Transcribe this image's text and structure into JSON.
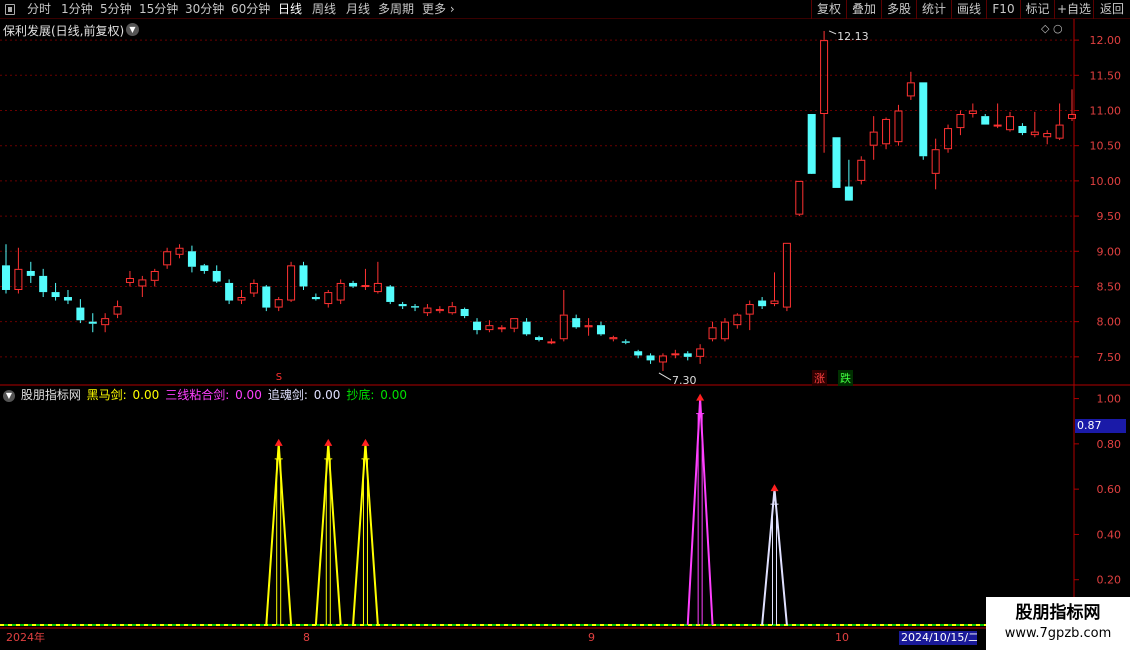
{
  "toolbar": {
    "left_items": [
      {
        "label": "分时",
        "active": false
      },
      {
        "label": "1分钟",
        "active": false
      },
      {
        "label": "5分钟",
        "active": false
      },
      {
        "label": "15分钟",
        "active": false
      },
      {
        "label": "30分钟",
        "active": false
      },
      {
        "label": "60分钟",
        "active": false
      },
      {
        "label": "日线",
        "active": true
      },
      {
        "label": "周线",
        "active": false
      },
      {
        "label": "月线",
        "active": false
      },
      {
        "label": "多周期",
        "active": false
      },
      {
        "label": "更多",
        "active": false
      }
    ],
    "right_items": [
      "复权",
      "叠加",
      "多股",
      "统计",
      "画线",
      "F10",
      "标记",
      "+自选",
      "返回"
    ]
  },
  "main_panel": {
    "title": "保利发展(日线,前复权)",
    "high_label": "12.13",
    "low_label": "7.30",
    "tag_up": "涨",
    "tag_down": "跌",
    "s_marker": "S"
  },
  "indicator_panel": {
    "name": "股朋指标网",
    "lines": [
      {
        "label": "黑马剑:",
        "value": "0.00",
        "color": "#ffff00"
      },
      {
        "label": "三线粘合剑:",
        "value": "0.00",
        "color": "#ff40ff"
      },
      {
        "label": "追魂剑:",
        "value": "0.00",
        "color": "#e0e0ff"
      },
      {
        "label": "抄底:",
        "value": "0.00",
        "color": "#00e000"
      }
    ],
    "current_value": "0.87"
  },
  "footer": {
    "year_label": "2024年",
    "month_labels": [
      "8",
      "9",
      "10"
    ],
    "selected_date": "2024/10/15/二"
  },
  "watermark": {
    "line1": "股朋指标网",
    "line2": "www.7gpzb.com"
  },
  "colors": {
    "up": "#ff3232",
    "down": "#54fcfc",
    "axis": "#b00000"
  },
  "chart_data": [
    {
      "type": "candlestick",
      "title": "保利发展(日线,前复权)",
      "y_ticks": [
        7.5,
        8.0,
        8.5,
        9.0,
        9.5,
        10.0,
        10.5,
        11.0,
        11.5,
        12.0
      ],
      "ylim": [
        7.1,
        12.3
      ],
      "high": 12.13,
      "low": 7.3,
      "candles": [
        [
          8.8,
          9.1,
          8.4,
          8.45
        ],
        [
          8.45,
          9.05,
          8.4,
          8.75
        ],
        [
          8.72,
          8.85,
          8.55,
          8.65
        ],
        [
          8.65,
          8.75,
          8.35,
          8.42
        ],
        [
          8.42,
          8.55,
          8.3,
          8.35
        ],
        [
          8.35,
          8.45,
          8.25,
          8.3
        ],
        [
          8.2,
          8.32,
          7.98,
          8.02
        ],
        [
          8.0,
          8.12,
          7.85,
          7.97
        ],
        [
          7.95,
          8.12,
          7.85,
          8.05
        ],
        [
          8.1,
          8.3,
          8.05,
          8.22
        ],
        [
          8.55,
          8.72,
          8.5,
          8.62
        ],
        [
          8.5,
          8.65,
          8.35,
          8.6
        ],
        [
          8.58,
          8.75,
          8.5,
          8.72
        ],
        [
          8.8,
          9.05,
          8.75,
          9.0
        ],
        [
          8.95,
          9.1,
          8.9,
          9.05
        ],
        [
          9.0,
          9.08,
          8.7,
          8.78
        ],
        [
          8.8,
          8.82,
          8.68,
          8.72
        ],
        [
          8.72,
          8.8,
          8.55,
          8.57
        ],
        [
          8.55,
          8.6,
          8.25,
          8.3
        ],
        [
          8.3,
          8.45,
          8.25,
          8.35
        ],
        [
          8.4,
          8.6,
          8.35,
          8.55
        ],
        [
          8.5,
          8.52,
          8.15,
          8.2
        ],
        [
          8.2,
          8.35,
          8.15,
          8.32
        ],
        [
          8.3,
          8.85,
          8.28,
          8.8
        ],
        [
          8.8,
          8.85,
          8.45,
          8.5
        ],
        [
          8.35,
          8.4,
          8.3,
          8.32
        ],
        [
          8.25,
          8.45,
          8.2,
          8.42
        ],
        [
          8.3,
          8.6,
          8.25,
          8.55
        ],
        [
          8.55,
          8.58,
          8.48,
          8.5
        ],
        [
          8.5,
          8.75,
          8.45,
          8.52
        ],
        [
          8.42,
          8.85,
          8.4,
          8.55
        ],
        [
          8.5,
          8.52,
          8.25,
          8.28
        ],
        [
          8.25,
          8.28,
          8.18,
          8.22
        ],
        [
          8.22,
          8.25,
          8.15,
          8.2
        ],
        [
          8.12,
          8.25,
          8.08,
          8.2
        ],
        [
          8.15,
          8.22,
          8.12,
          8.18
        ],
        [
          8.12,
          8.28,
          8.1,
          8.22
        ],
        [
          8.18,
          8.2,
          8.05,
          8.08
        ],
        [
          8.0,
          8.05,
          7.82,
          7.88
        ],
        [
          7.88,
          8.02,
          7.85,
          7.95
        ],
        [
          7.9,
          7.95,
          7.85,
          7.92
        ],
        [
          7.9,
          8.05,
          7.85,
          8.05
        ],
        [
          8.0,
          8.05,
          7.8,
          7.82
        ],
        [
          7.78,
          7.8,
          7.72,
          7.74
        ],
        [
          7.72,
          7.76,
          7.68,
          7.72
        ],
        [
          7.75,
          8.45,
          7.72,
          8.1
        ],
        [
          8.05,
          8.1,
          7.9,
          7.92
        ],
        [
          7.92,
          8.05,
          7.8,
          7.95
        ],
        [
          7.95,
          8.0,
          7.8,
          7.82
        ],
        [
          7.75,
          7.8,
          7.72,
          7.78
        ],
        [
          7.72,
          7.75,
          7.68,
          7.7
        ],
        [
          7.58,
          7.6,
          7.48,
          7.52
        ],
        [
          7.52,
          7.55,
          7.4,
          7.45
        ],
        [
          7.42,
          7.55,
          7.3,
          7.52
        ],
        [
          7.55,
          7.6,
          7.48,
          7.55
        ],
        [
          7.55,
          7.58,
          7.45,
          7.5
        ],
        [
          7.5,
          7.68,
          7.4,
          7.62
        ],
        [
          7.75,
          8.0,
          7.72,
          7.92
        ],
        [
          7.75,
          8.05,
          7.72,
          8.0
        ],
        [
          7.95,
          8.12,
          7.9,
          8.1
        ],
        [
          8.1,
          8.3,
          7.88,
          8.25
        ],
        [
          8.3,
          8.35,
          8.18,
          8.22
        ],
        [
          8.25,
          8.7,
          8.22,
          8.3
        ],
        [
          8.2,
          9.12,
          8.15,
          9.12
        ],
        [
          9.52,
          10.0,
          9.5,
          10.0
        ],
        [
          10.95,
          10.95,
          10.2,
          10.1
        ],
        [
          10.95,
          12.13,
          10.4,
          12.0
        ],
        [
          10.62,
          10.62,
          9.9,
          9.9
        ],
        [
          9.92,
          10.3,
          9.75,
          9.72
        ],
        [
          10.0,
          10.35,
          9.95,
          10.3
        ],
        [
          10.5,
          10.92,
          10.3,
          10.7
        ],
        [
          10.52,
          10.9,
          10.45,
          10.88
        ],
        [
          10.55,
          11.08,
          10.5,
          11.0
        ],
        [
          11.2,
          11.55,
          11.15,
          11.4
        ],
        [
          11.4,
          11.4,
          10.3,
          10.35
        ],
        [
          10.1,
          10.6,
          9.88,
          10.45
        ],
        [
          10.45,
          10.8,
          10.4,
          10.75
        ],
        [
          10.75,
          11.0,
          10.65,
          10.95
        ],
        [
          10.95,
          11.1,
          10.9,
          11.0
        ],
        [
          10.92,
          10.95,
          10.8,
          10.8
        ],
        [
          10.8,
          11.1,
          10.75,
          10.8
        ],
        [
          10.72,
          10.98,
          10.7,
          10.92
        ],
        [
          10.78,
          10.82,
          10.65,
          10.68
        ],
        [
          10.65,
          10.98,
          10.62,
          10.7
        ],
        [
          10.62,
          10.72,
          10.52,
          10.68
        ],
        [
          10.6,
          11.1,
          10.58,
          10.8
        ],
        [
          10.88,
          11.3,
          10.85,
          10.95
        ]
      ]
    },
    {
      "type": "line",
      "title": "股朋指标网",
      "y_ticks": [
        0.2,
        0.4,
        0.6,
        0.8,
        1.0
      ],
      "ylim": [
        0.0,
        1.06
      ],
      "series": [
        {
          "name": "黑马剑",
          "signal_bars": [
            22,
            26,
            29
          ],
          "peak": 0.8,
          "color": "#ffff00"
        },
        {
          "name": "三线粘合剑",
          "signal_bars": [
            56
          ],
          "peak": 1.0,
          "color": "#ff40ff"
        },
        {
          "name": "追魂剑",
          "signal_bars": [
            62
          ],
          "peak": 0.6,
          "color": "#e0e0ff"
        },
        {
          "name": "抄底",
          "signal_bars": [],
          "peak": 0.0,
          "color": "#00e000"
        }
      ]
    }
  ]
}
